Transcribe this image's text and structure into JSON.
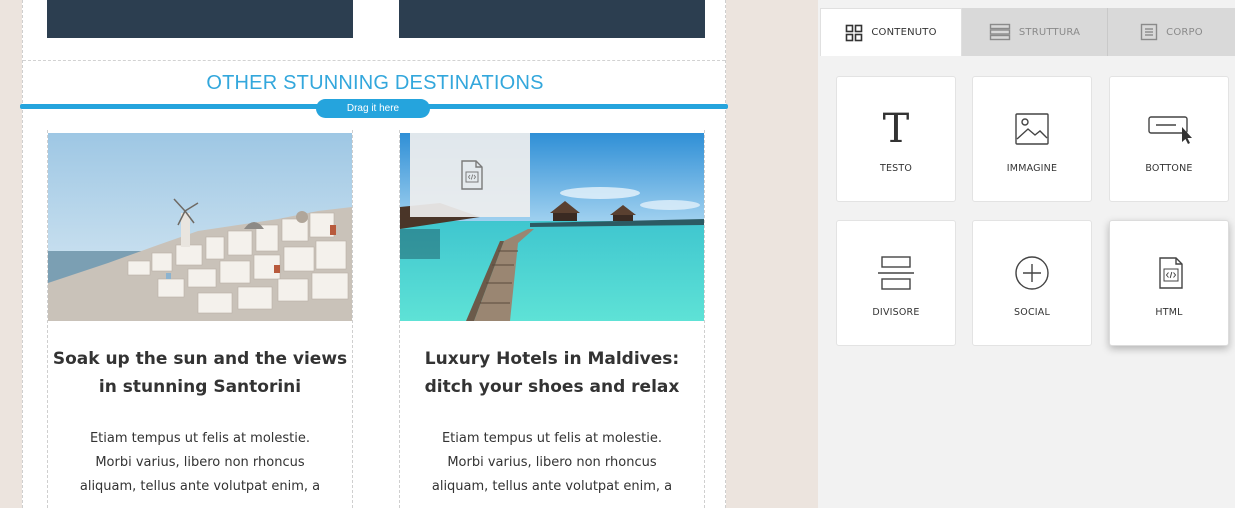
{
  "canvas": {
    "section_title": "OTHER STUNNING DESTINATIONS",
    "drop_hint": "Drag it here",
    "cards": [
      {
        "title_line1": "Soak up the sun and the views",
        "title_line2": "in stunning Santorini",
        "body_lines": [
          "Etiam tempus ut felis at molestie.",
          "Morbi varius, libero non rhoncus",
          "aliquam, tellus ante volutpat enim, a"
        ],
        "image": "santorini-photo"
      },
      {
        "title_line1": "Luxury Hotels in Maldives:",
        "title_line2": "ditch your shoes and relax",
        "body_lines": [
          "Etiam tempus ut felis at molestie.",
          "Morbi varius, libero non rhoncus",
          "aliquam, tellus ante volutpat enim, a"
        ],
        "image": "maldives-photo"
      }
    ]
  },
  "panel": {
    "tabs": [
      {
        "label": "CONTENUTO",
        "icon": "grid-icon",
        "active": true
      },
      {
        "label": "STRUTTURA",
        "icon": "rows-icon",
        "active": false
      },
      {
        "label": "CORPO",
        "icon": "page-icon",
        "active": false
      }
    ],
    "tiles": [
      {
        "label": "TESTO",
        "icon": "text-icon"
      },
      {
        "label": "IMMAGINE",
        "icon": "image-icon"
      },
      {
        "label": "BOTTONE",
        "icon": "button-icon"
      },
      {
        "label": "DIVISORE",
        "icon": "divider-icon"
      },
      {
        "label": "SOCIAL",
        "icon": "social-icon"
      },
      {
        "label": "HTML",
        "icon": "html-icon"
      }
    ],
    "text_icon_glyph": "T"
  },
  "colors": {
    "accent": "#25a4dd",
    "title": "#33a7dc",
    "dark_block": "#2c3e50",
    "canvas_bg": "#ece4de",
    "panel_bg": "#f2f2f2"
  }
}
